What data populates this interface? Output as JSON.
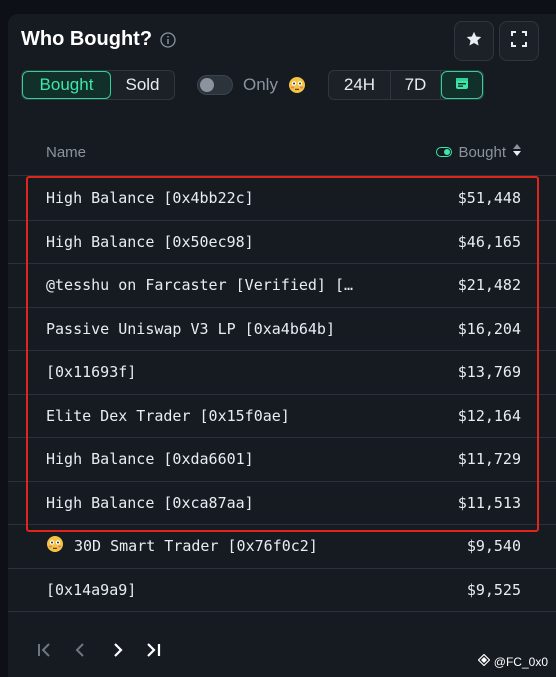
{
  "header": {
    "title": "Who Bought?"
  },
  "tabs": [
    {
      "label": "Bought",
      "active": true
    },
    {
      "label": "Sold",
      "active": false
    }
  ],
  "filter": {
    "only_label": "Only"
  },
  "time_ranges": [
    {
      "label": "24H",
      "active": false
    },
    {
      "label": "7D",
      "active": false
    }
  ],
  "table": {
    "name_header": "Name",
    "value_header": "Bought",
    "rows": [
      {
        "name": "High Balance [0x4bb22c]",
        "value": "$51,448"
      },
      {
        "name": "High Balance [0x50ec98]",
        "value": "$46,165"
      },
      {
        "name": "@tesshu on Farcaster [Verified] […",
        "value": "$21,482"
      },
      {
        "name": "Passive Uniswap V3 LP [0xa4b64b]",
        "value": "$16,204"
      },
      {
        "name": "[0x11693f]",
        "value": "$13,769"
      },
      {
        "name": "Elite Dex Trader [0x15f0ae]",
        "value": "$12,164"
      },
      {
        "name": "High Balance [0xda6601]",
        "value": "$11,729"
      },
      {
        "name": "High Balance [0xca87aa]",
        "value": "$11,513"
      },
      {
        "name": "30D Smart Trader [0x76f0c2]",
        "value": "$9,540"
      },
      {
        "name": "[0x14a9a9]",
        "value": "$9,525"
      }
    ]
  },
  "watermark": "@FC_0x0",
  "colors": {
    "accent": "#3ee6a8",
    "highlight": "#e0251b",
    "background": "#161b22"
  }
}
